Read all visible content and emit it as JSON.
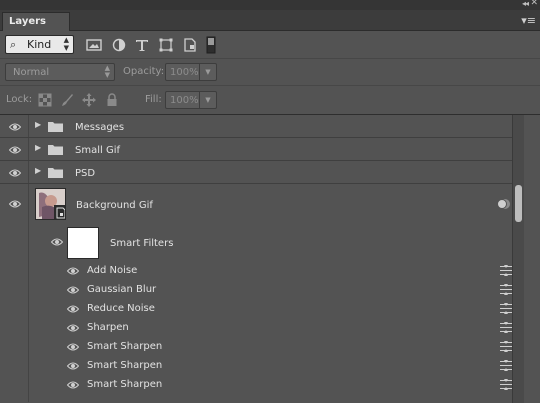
{
  "panel": {
    "tab_label": "Layers",
    "collapse_glyph": "◂◂",
    "close_glyph": "✕",
    "menu_glyph": "▾≡"
  },
  "filter": {
    "kind_label": "Kind",
    "icons": [
      "pixel-filter-icon",
      "adjustment-filter-icon",
      "type-filter-icon",
      "shape-filter-icon",
      "smart-object-filter-icon",
      "filter-toggle-icon"
    ]
  },
  "blend": {
    "mode": "Normal",
    "opacity_label": "Opacity:",
    "opacity_value": "100%"
  },
  "lock": {
    "label": "Lock:",
    "fill_label": "Fill:",
    "fill_value": "100%"
  },
  "layers": [
    {
      "name": "Messages",
      "type": "group"
    },
    {
      "name": "Small Gif",
      "type": "group"
    },
    {
      "name": "PSD",
      "type": "group"
    },
    {
      "name": "Background Gif",
      "type": "smart-object"
    }
  ],
  "smart_filters": {
    "label": "Smart Filters",
    "items": [
      "Add Noise",
      "Gaussian Blur",
      "Reduce Noise",
      "Sharpen",
      "Smart Sharpen",
      "Smart Sharpen",
      "Smart Sharpen"
    ]
  },
  "colors": {
    "panel_bg": "#535353",
    "header_bg": "#3c3c3c",
    "text": "#e3e3e3"
  }
}
